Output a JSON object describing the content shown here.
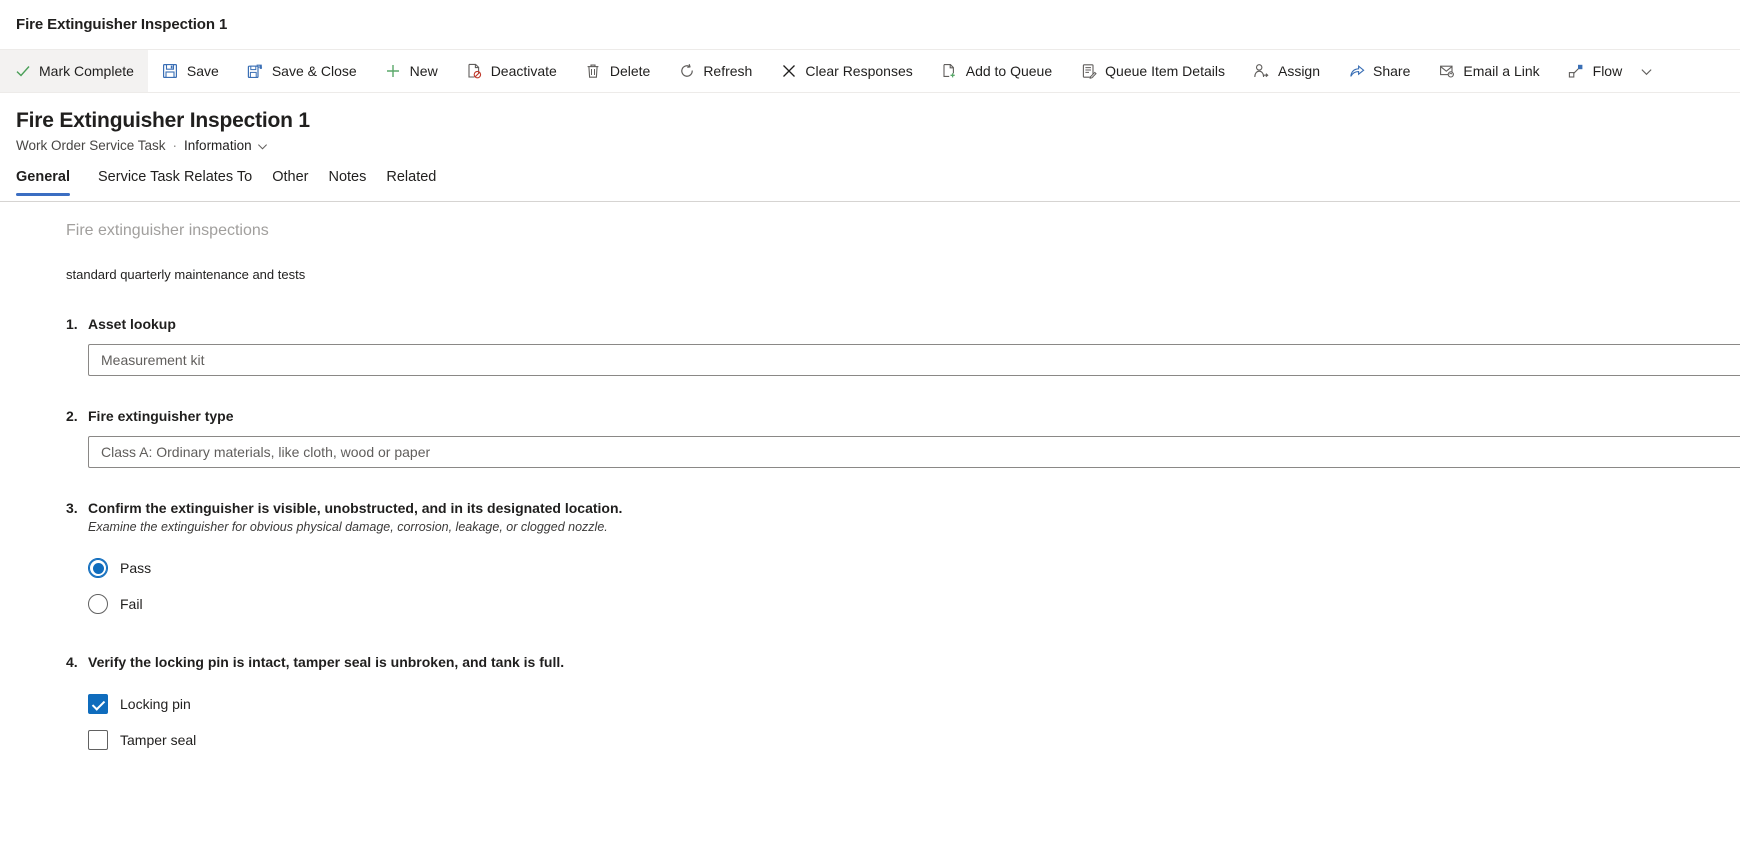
{
  "app": {
    "title": "Fire Extinguisher Inspection 1"
  },
  "colors": {
    "accent": "#0f6cbd",
    "tab_underline": "#3b6ec2",
    "checked_fill": "#0f6cbd",
    "muted_text": "#a19f9d",
    "border": "#8a8886"
  },
  "commandbar": {
    "items": [
      {
        "label": "Mark Complete",
        "icon": "checkmark-icon",
        "highlighted": true
      },
      {
        "label": "Save",
        "icon": "save-icon",
        "highlighted": false
      },
      {
        "label": "Save & Close",
        "icon": "save-and-close-icon",
        "highlighted": false
      },
      {
        "label": "New",
        "icon": "plus-icon",
        "highlighted": false
      },
      {
        "label": "Deactivate",
        "icon": "deactivate-icon",
        "highlighted": false
      },
      {
        "label": "Delete",
        "icon": "trash-icon",
        "highlighted": false
      },
      {
        "label": "Refresh",
        "icon": "refresh-icon",
        "highlighted": false
      },
      {
        "label": "Clear Responses",
        "icon": "close-x-icon",
        "highlighted": false
      },
      {
        "label": "Add to Queue",
        "icon": "add-to-queue-icon",
        "highlighted": false
      },
      {
        "label": "Queue Item Details",
        "icon": "queue-item-details-icon",
        "highlighted": false
      },
      {
        "label": "Assign",
        "icon": "assign-person-icon",
        "highlighted": false
      },
      {
        "label": "Share",
        "icon": "share-icon",
        "highlighted": false
      },
      {
        "label": "Email a Link",
        "icon": "email-link-icon",
        "highlighted": false
      },
      {
        "label": "Flow",
        "icon": "flow-icon",
        "highlighted": false
      }
    ],
    "overflow_icon": "chevron-down-icon"
  },
  "record": {
    "title": "Fire Extinguisher Inspection 1",
    "entity": "Work Order Service Task",
    "separator": "·",
    "form_name": "Information",
    "form_chevron_icon": "chevron-down-icon"
  },
  "tabs": [
    {
      "label": "General",
      "active": true
    },
    {
      "label": "Service Task Relates To",
      "active": false
    },
    {
      "label": "Other",
      "active": false
    },
    {
      "label": "Notes",
      "active": false
    },
    {
      "label": "Related",
      "active": false
    }
  ],
  "inspection": {
    "section_title": "Fire extinguisher inspections",
    "section_description": "standard quarterly maintenance and tests",
    "questions": [
      {
        "number": "1.",
        "text": "Asset lookup",
        "hint": "",
        "type": "text",
        "value": "",
        "placeholder": "Measurement kit"
      },
      {
        "number": "2.",
        "text": "Fire extinguisher type",
        "hint": "",
        "type": "text",
        "value": "",
        "placeholder": "Class A: Ordinary materials, like cloth, wood or paper"
      },
      {
        "number": "3.",
        "text": "Confirm the extinguisher is visible, unobstructed, and in its designated location.",
        "hint": "Examine the extinguisher for obvious physical damage, corrosion, leakage, or clogged nozzle.",
        "type": "radio",
        "options": [
          {
            "label": "Pass",
            "checked": true
          },
          {
            "label": "Fail",
            "checked": false
          }
        ]
      },
      {
        "number": "4.",
        "text": "Verify the locking pin is intact, tamper seal is unbroken, and tank is full.",
        "hint": "",
        "type": "checkbox",
        "options": [
          {
            "label": "Locking pin",
            "checked": true
          },
          {
            "label": "Tamper seal",
            "checked": false
          }
        ]
      }
    ]
  }
}
